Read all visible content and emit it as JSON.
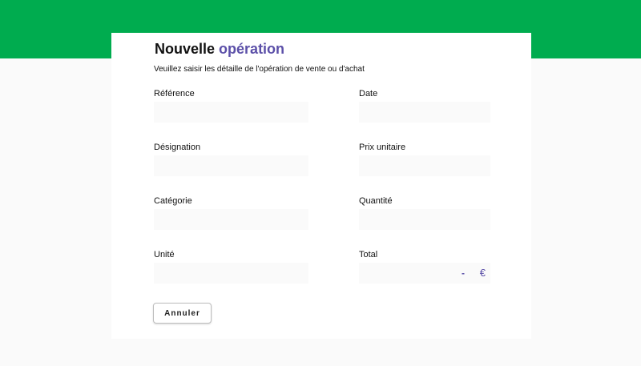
{
  "header": {
    "title_main": "Nouvelle",
    "title_accent": "opération",
    "subtitle": "Veuillez saisir les détaille de l'opération de vente ou d'achat"
  },
  "form": {
    "reference": {
      "label": "Référence",
      "value": ""
    },
    "date": {
      "label": "Date",
      "value": ""
    },
    "designation": {
      "label": "Désignation",
      "value": ""
    },
    "unit_price": {
      "label": "Prix unitaire",
      "value": ""
    },
    "category": {
      "label": "Catégorie",
      "value": ""
    },
    "quantity": {
      "label": "Quantité",
      "value": ""
    },
    "unit": {
      "label": "Unité",
      "value": ""
    },
    "total": {
      "label": "Total",
      "value": "-",
      "currency": "€"
    }
  },
  "actions": {
    "cancel_label": "Annuler"
  },
  "colors": {
    "brand_green": "#00ac4f",
    "accent_purple": "#5b4fa8",
    "input_bg": "#fafafa"
  }
}
